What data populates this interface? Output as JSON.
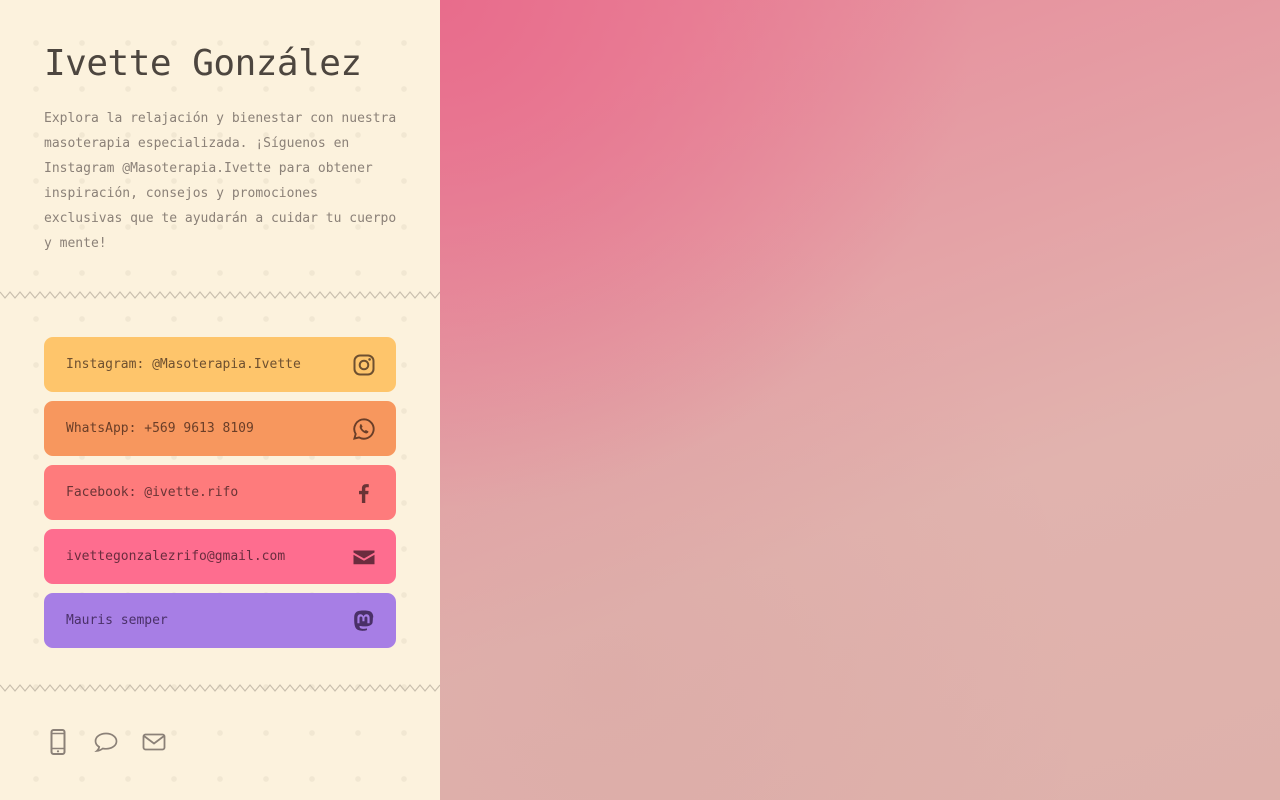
{
  "profile": {
    "name": "Ivette González",
    "description": "Explora la relajación y bienestar con nuestra masoterapia especializada. ¡Síguenos en Instagram @Masoterapia.Ivette para obtener inspiración, consejos y promociones exclusivas que te ayudarán a cuidar tu cuerpo y mente!"
  },
  "links": [
    {
      "label": "Instagram: @Masoterapia.Ivette",
      "icon": "instagram-icon",
      "color": "#fec56b",
      "text_color": "#6e5030"
    },
    {
      "label": "WhatsApp: +569 9613 8109",
      "icon": "whatsapp-icon",
      "color": "#f7975e",
      "text_color": "#6a3e28"
    },
    {
      "label": "Facebook: @ivette.rifo",
      "icon": "facebook-icon",
      "color": "#fe7b7c",
      "text_color": "#6a3436"
    },
    {
      "label": "ivettegonzalezrifo@gmail.com",
      "icon": "envelope-icon",
      "color": "#fe6d8f",
      "text_color": "#6a2c3e"
    },
    {
      "label": "Mauris semper",
      "icon": "mastodon-icon",
      "color": "#a77ee5",
      "text_color": "#4a3068"
    }
  ],
  "footer": {
    "icons": [
      "mobile-phone-icon",
      "speech-bubble-icon",
      "envelope-outline-icon"
    ],
    "icon_color": "#8b8178"
  },
  "colors": {
    "sidebar_background": "#fcf2dd",
    "title": "#4d463f",
    "body_text": "#8b8178",
    "hero_gradient_start": "#e8708e",
    "hero_gradient_end": "#deb1ab"
  }
}
